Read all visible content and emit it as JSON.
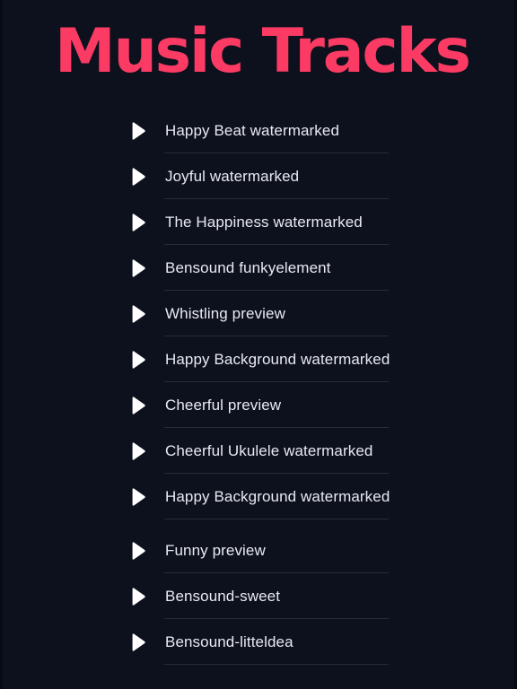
{
  "header": {
    "title": "Music Tracks",
    "title_color": "#fb3b64"
  },
  "theme": {
    "background": "#0d111d",
    "text_color": "#e9e9f2",
    "divider_color": "#272c3a",
    "icon_color": "#ffffff"
  },
  "list": {
    "play_icon_name": "play-icon",
    "tracks": [
      {
        "title": "Happy Beat watermarked"
      },
      {
        "title": "Joyful watermarked"
      },
      {
        "title": "The Happiness watermarked"
      },
      {
        "title": "Bensound funkyelement"
      },
      {
        "title": "Whistling preview"
      },
      {
        "title": "Happy Background watermarked"
      },
      {
        "title": "Cheerful preview"
      },
      {
        "title": "Cheerful Ukulele watermarked"
      },
      {
        "title": "Happy Background watermarked"
      },
      {
        "title": "Funny preview"
      },
      {
        "title": "Bensound-sweet"
      },
      {
        "title": "Bensound-litteldea"
      }
    ]
  }
}
